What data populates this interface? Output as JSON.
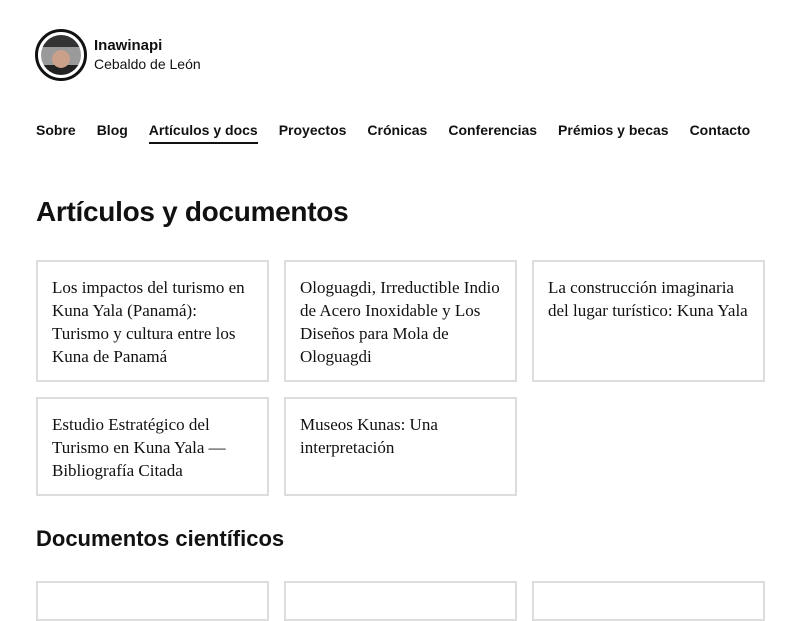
{
  "site": {
    "title": "Inawinapi",
    "subtitle": "Cebaldo de León"
  },
  "nav": [
    {
      "label": "Sobre"
    },
    {
      "label": "Blog"
    },
    {
      "label": "Artículos y docs",
      "active": true
    },
    {
      "label": "Proyectos"
    },
    {
      "label": "Crónicas"
    },
    {
      "label": "Conferencias"
    },
    {
      "label": "Prémios y becas"
    },
    {
      "label": "Contacto"
    }
  ],
  "main": {
    "heading": "Artículos y documentos",
    "cards": [
      {
        "title": "Los impactos del turismo en Kuna Yala (Panamá): Turismo y cultura entre los Kuna de Panamá"
      },
      {
        "title": "Ologuagdi, Irreductible Indio de Acero Inoxidable y Los Diseños para Mola de Ologuagdi"
      },
      {
        "title": "La construcción imaginaria del lugar turístico: Kuna Yala"
      },
      {
        "title": "Estudio Estratégico del Turismo en Kuna Yala — Bibliografía Citada"
      },
      {
        "title": "Museos Kunas: Una interpretación"
      }
    ],
    "section2_heading": "Documentos científicos"
  }
}
